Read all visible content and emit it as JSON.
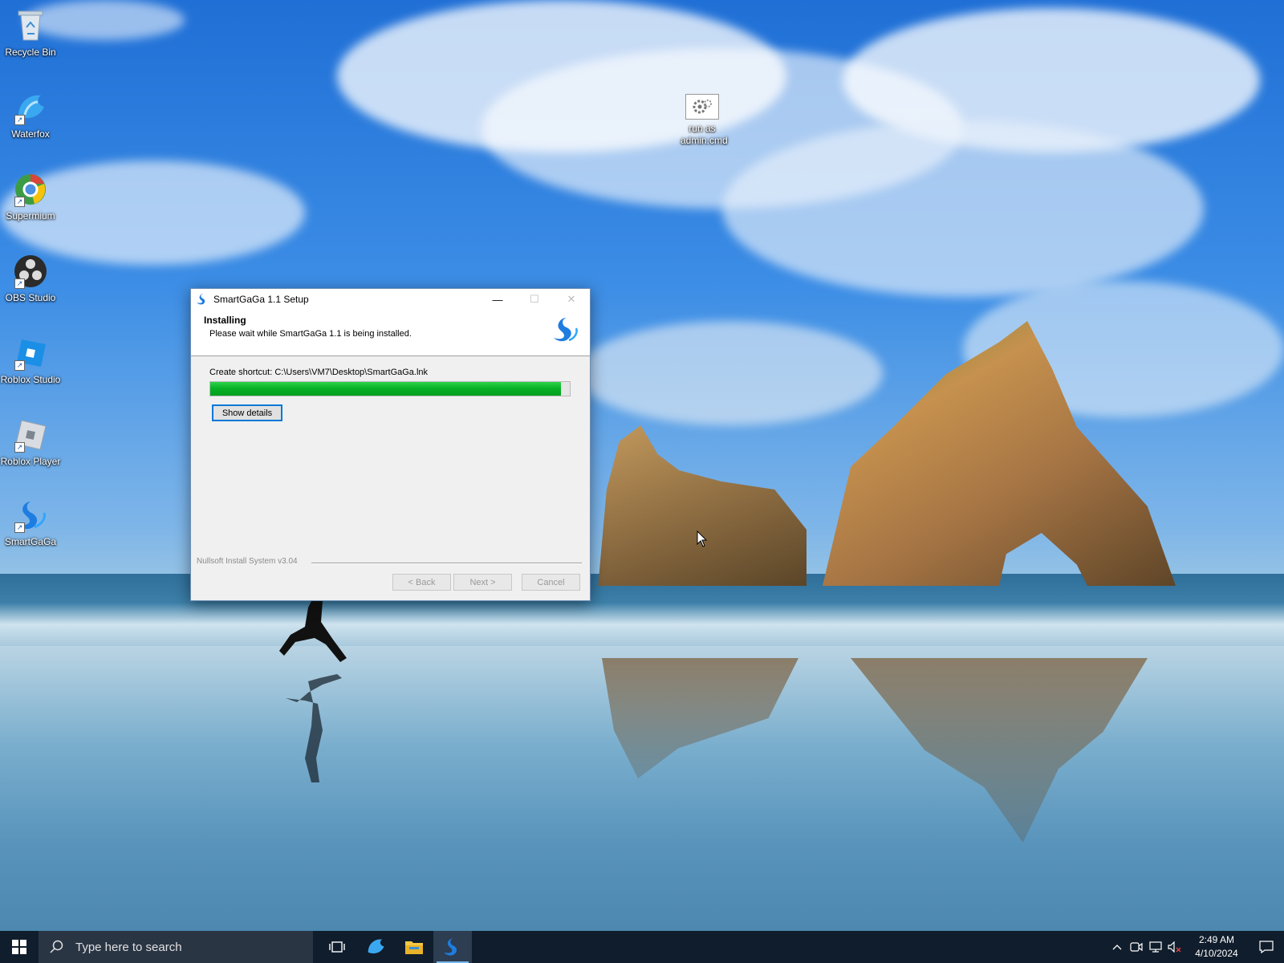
{
  "desktop": {
    "icons": [
      {
        "label": "Recycle Bin"
      },
      {
        "label": "Waterfox"
      },
      {
        "label": "Supermium"
      },
      {
        "label": "OBS Studio"
      },
      {
        "label": "Roblox Studio"
      },
      {
        "label": "Roblox Player"
      },
      {
        "label": "SmartGaGa"
      },
      {
        "label": "run as admin.cmd"
      }
    ]
  },
  "installer": {
    "title": "SmartGaGa 1.1 Setup",
    "header_title": "Installing",
    "header_subtitle": "Please wait while SmartGaGa 1.1 is being installed.",
    "status_text": "Create shortcut: C:\\Users\\VM7\\Desktop\\SmartGaGa.lnk",
    "progress_fraction": 0.975,
    "show_details_label": "Show details",
    "branding": "Nullsoft Install System v3.04",
    "back_label": "< Back",
    "next_label": "Next >",
    "cancel_label": "Cancel",
    "minimize_glyph": "—",
    "maximize_glyph": "☐",
    "close_glyph": "✕"
  },
  "taskbar": {
    "search_placeholder": "Type here to search",
    "apps": [
      "task-view-icon",
      "waterfox-icon",
      "file-explorer-icon",
      "smartgaga-icon"
    ],
    "active_app": "smartgaga-icon",
    "clock_time": "2:49 AM",
    "clock_date": "4/10/2024",
    "tray_icons": [
      "chevron-up-icon",
      "meet-now-icon",
      "network-icon",
      "volume-muted-icon"
    ]
  },
  "colors": {
    "progress": "#06b025",
    "taskbar": "#101d2c",
    "accent": "#0078d7"
  }
}
